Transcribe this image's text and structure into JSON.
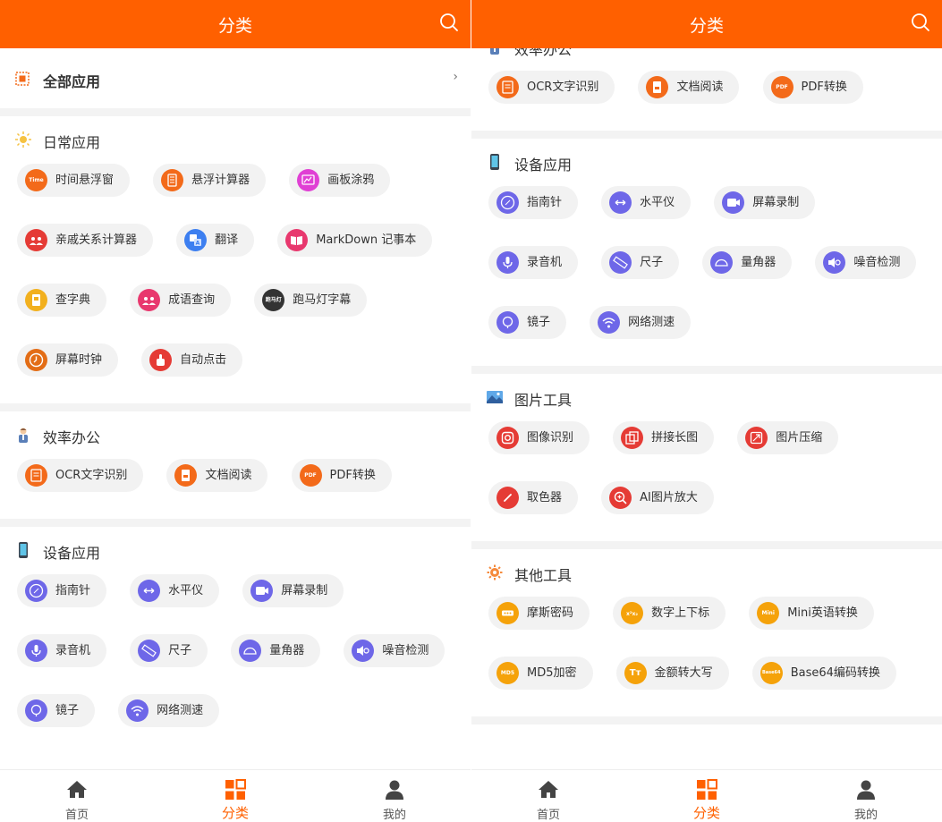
{
  "header": {
    "title": "分类"
  },
  "all_apps": {
    "label": "全部应用",
    "chevron": "›"
  },
  "sections": {
    "daily": {
      "title": "日常应用",
      "items": [
        "时间悬浮窗",
        "悬浮计算器",
        "画板涂鸦",
        "亲戚关系计算器",
        "翻译",
        "MarkDown 记事本",
        "查字典",
        "成语查询",
        "跑马灯字幕",
        "屏幕时钟",
        "自动点击"
      ]
    },
    "office": {
      "title": "效率办公",
      "items": [
        "OCR文字识别",
        "文档阅读",
        "PDF转换"
      ]
    },
    "device": {
      "title": "设备应用",
      "items": [
        "指南针",
        "水平仪",
        "屏幕录制",
        "录音机",
        "尺子",
        "量角器",
        "噪音检测",
        "镜子",
        "网络测速"
      ]
    },
    "image": {
      "title": "图片工具",
      "items": [
        "图像识别",
        "拼接长图",
        "图片压缩",
        "取色器",
        "AI图片放大"
      ]
    },
    "other": {
      "title": "其他工具",
      "items": [
        "摩斯密码",
        "数字上下标",
        "Mini英语转换",
        "MD5加密",
        "金额转大写",
        "Base64编码转换"
      ]
    }
  },
  "icon_text": {
    "time": "Time",
    "pdf": "PDF",
    "marquee": "跑马灯",
    "mini": "Mini",
    "md5": "MD5",
    "tt": "Tт",
    "base64": "Base64"
  },
  "tabs": [
    {
      "label": "首页",
      "icon": "home-icon"
    },
    {
      "label": "分类",
      "icon": "category-icon",
      "active": true
    },
    {
      "label": "我的",
      "icon": "user-icon"
    }
  ],
  "colors": {
    "brand": "#ff6000",
    "chip_bg": "#f2f2f2",
    "device_icon": "#6e67e8"
  }
}
